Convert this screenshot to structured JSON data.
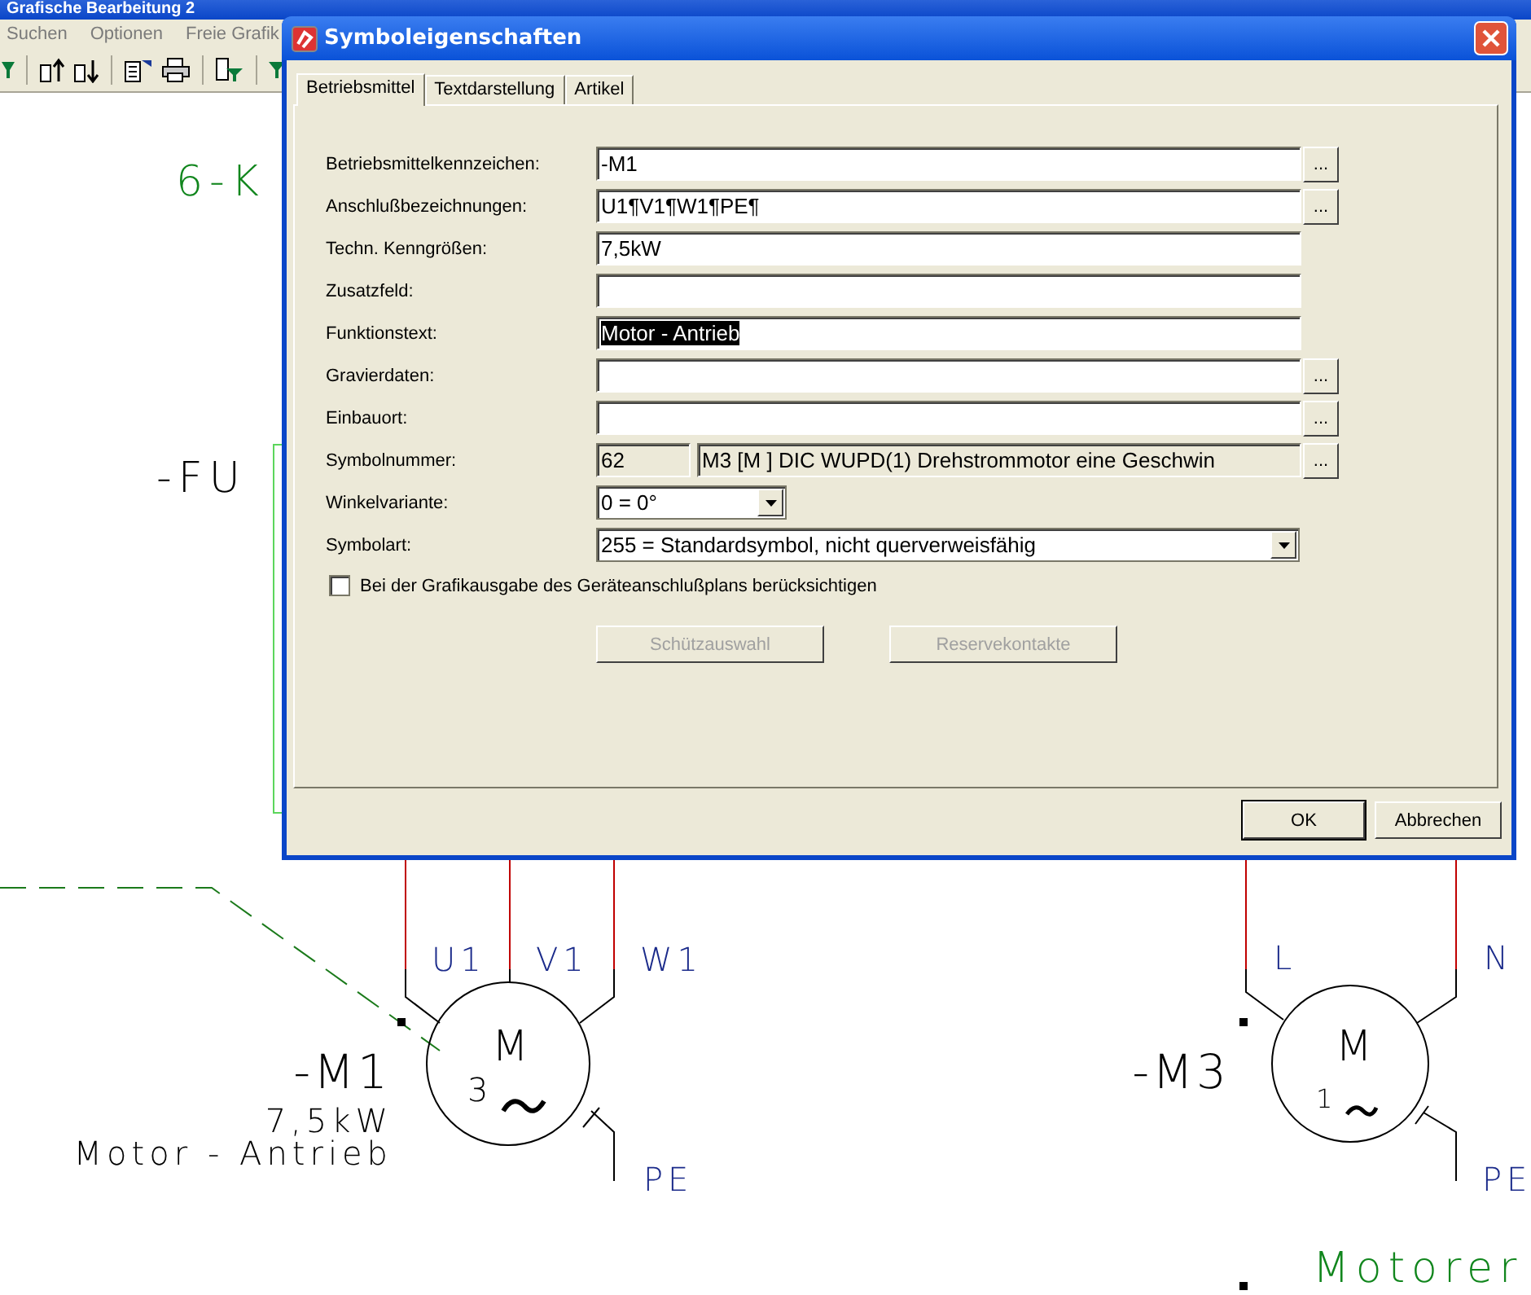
{
  "app": {
    "title": "Grafische Bearbeitung 2",
    "menu": [
      "Suchen",
      "Optionen",
      "Freie Grafik"
    ]
  },
  "schematic": {
    "cross_ref": "6-K",
    "group_tag": "-FU",
    "bottom_text": "Motorer",
    "motor_1": {
      "tag": "-M1",
      "rating": "7,5kW",
      "function": "Motor - Antrieb",
      "symbol": "M",
      "phases": "3",
      "terminals": [
        "U1",
        "V1",
        "W1"
      ],
      "pe": "PE"
    },
    "motor_2": {
      "tag": "-M3",
      "symbol": "M",
      "phases": "1",
      "terminals": [
        "L",
        "N"
      ],
      "pe": "PE"
    }
  },
  "dialog": {
    "title": "Symboleigenschaften",
    "tabs": [
      {
        "label": "Betriebsmittel",
        "selected": true
      },
      {
        "label": "Textdarstellung",
        "selected": false
      },
      {
        "label": "Artikel",
        "selected": false
      }
    ],
    "fields": [
      {
        "kind": "text",
        "label": "Betriebsmittelkennzeichen:",
        "value": "-M1",
        "text_selected": false,
        "browse": "..."
      },
      {
        "kind": "text",
        "label": "Anschlußbezeichnungen:",
        "value": "U1¶V1¶W1¶PE¶",
        "text_selected": false,
        "browse": "..."
      },
      {
        "kind": "text",
        "label": "Techn. Kenngrößen:",
        "value": "7,5kW",
        "text_selected": false
      },
      {
        "kind": "text",
        "label": "Zusatzfeld:"
      },
      {
        "kind": "text",
        "label": "Funktionstext:",
        "value": "Motor - Antrieb",
        "text_selected": true
      },
      {
        "kind": "text",
        "label": "Gravierdaten:",
        "browse": "..."
      },
      {
        "kind": "text",
        "label": "Einbauort:",
        "browse": "..."
      },
      {
        "kind": "symbol",
        "label": "Symbolnummer:",
        "number": "62",
        "value": "M3 [M  ] DIC  WUPD(1) Drehstrommotor eine Geschwin",
        "browse": "..."
      },
      {
        "kind": "short_combo",
        "label": "Winkelvariante:",
        "value": "0 = 0°"
      },
      {
        "kind": "combo",
        "label": "Symbolart:",
        "value": "255 = Standardsymbol, nicht querverweisfähig"
      }
    ],
    "checkbox": {
      "label": "Bei der Grafikausgabe des Geräteanschlußplans berücksichtigen",
      "checked": false
    },
    "actions": [
      {
        "label": "Schützauswahl",
        "disabled": true
      },
      {
        "label": "Reservekontakte",
        "disabled": true
      }
    ],
    "footer": [
      "OK",
      "Abbrechen"
    ]
  }
}
